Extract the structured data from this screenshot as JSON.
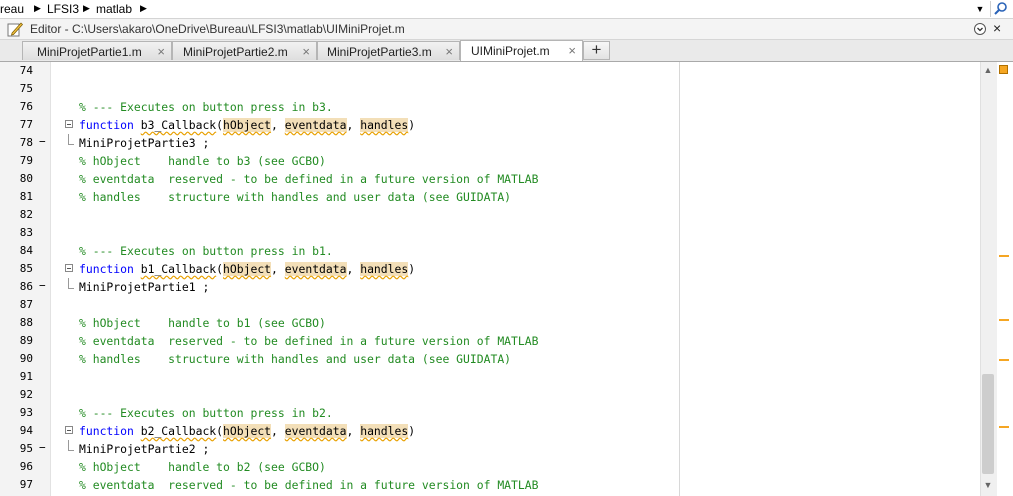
{
  "breadcrumb": {
    "items": [
      "reau",
      "LFSI3",
      "matlab"
    ]
  },
  "editor": {
    "title": "Editor - C:\\Users\\akaro\\OneDrive\\Bureau\\LFSI3\\matlab\\UIMiniProjet.m",
    "close_glyph": "×"
  },
  "tabs": [
    {
      "label": "MiniProjetPartie1.m",
      "active": false
    },
    {
      "label": "MiniProjetPartie2.m",
      "active": false
    },
    {
      "label": "MiniProjetPartie3.m",
      "active": false
    },
    {
      "label": "UIMiniProjet.m",
      "active": true
    }
  ],
  "tab_close_glyph": "×",
  "tab_add_glyph": "+",
  "colors": {
    "comment": "#228b22",
    "keyword": "#0000ff",
    "highlight": "#f3dfb8",
    "warning": "#f5a623"
  },
  "code_lines": [
    {
      "n": "74",
      "dash": "",
      "fold": "",
      "segments": []
    },
    {
      "n": "75",
      "dash": "",
      "fold": "",
      "segments": []
    },
    {
      "n": "76",
      "dash": "",
      "fold": "",
      "segments": [
        {
          "t": "% --- Executes on button press in b3.",
          "c": "cmt"
        }
      ]
    },
    {
      "n": "77",
      "dash": "",
      "fold": "start",
      "segments": [
        {
          "t": "function",
          "c": "kw"
        },
        {
          "t": " ",
          "c": ""
        },
        {
          "t": "b3_Callback",
          "c": "fn"
        },
        {
          "t": "(",
          "c": ""
        },
        {
          "t": "hObject",
          "c": "hl"
        },
        {
          "t": ", ",
          "c": ""
        },
        {
          "t": "eventdata",
          "c": "hl"
        },
        {
          "t": ", ",
          "c": ""
        },
        {
          "t": "handles",
          "c": "hl"
        },
        {
          "t": ")",
          "c": ""
        }
      ]
    },
    {
      "n": "78",
      "dash": "−",
      "fold": "end",
      "segments": [
        {
          "t": "MiniProjetPartie3 ;",
          "c": ""
        }
      ]
    },
    {
      "n": "79",
      "dash": "",
      "fold": "",
      "segments": [
        {
          "t": "% hObject    handle to b3 (see GCBO)",
          "c": "cmt"
        }
      ]
    },
    {
      "n": "80",
      "dash": "",
      "fold": "",
      "segments": [
        {
          "t": "% eventdata  reserved - to be defined in a future version of MATLAB",
          "c": "cmt"
        }
      ]
    },
    {
      "n": "81",
      "dash": "",
      "fold": "",
      "segments": [
        {
          "t": "% handles    structure with handles and user data (see GUIDATA)",
          "c": "cmt"
        }
      ]
    },
    {
      "n": "82",
      "dash": "",
      "fold": "",
      "segments": []
    },
    {
      "n": "83",
      "dash": "",
      "fold": "",
      "segments": []
    },
    {
      "n": "84",
      "dash": "",
      "fold": "",
      "segments": [
        {
          "t": "% --- Executes on button press in b1.",
          "c": "cmt"
        }
      ]
    },
    {
      "n": "85",
      "dash": "",
      "fold": "start",
      "segments": [
        {
          "t": "function",
          "c": "kw"
        },
        {
          "t": " ",
          "c": ""
        },
        {
          "t": "b1_Callback",
          "c": "fn"
        },
        {
          "t": "(",
          "c": ""
        },
        {
          "t": "hObject",
          "c": "hl"
        },
        {
          "t": ", ",
          "c": ""
        },
        {
          "t": "eventdata",
          "c": "hl"
        },
        {
          "t": ", ",
          "c": ""
        },
        {
          "t": "handles",
          "c": "hl"
        },
        {
          "t": ")",
          "c": ""
        }
      ]
    },
    {
      "n": "86",
      "dash": "−",
      "fold": "end",
      "segments": [
        {
          "t": "MiniProjetPartie1 ;",
          "c": ""
        }
      ]
    },
    {
      "n": "87",
      "dash": "",
      "fold": "",
      "segments": []
    },
    {
      "n": "88",
      "dash": "",
      "fold": "",
      "segments": [
        {
          "t": "% hObject    handle to b1 (see GCBO)",
          "c": "cmt"
        }
      ]
    },
    {
      "n": "89",
      "dash": "",
      "fold": "",
      "segments": [
        {
          "t": "% eventdata  reserved - to be defined in a future version of MATLAB",
          "c": "cmt"
        }
      ]
    },
    {
      "n": "90",
      "dash": "",
      "fold": "",
      "segments": [
        {
          "t": "% handles    structure with handles and user data (see GUIDATA)",
          "c": "cmt"
        }
      ]
    },
    {
      "n": "91",
      "dash": "",
      "fold": "",
      "segments": []
    },
    {
      "n": "92",
      "dash": "",
      "fold": "",
      "segments": []
    },
    {
      "n": "93",
      "dash": "",
      "fold": "",
      "segments": [
        {
          "t": "% --- Executes on button press in b2.",
          "c": "cmt"
        }
      ]
    },
    {
      "n": "94",
      "dash": "",
      "fold": "start",
      "segments": [
        {
          "t": "function",
          "c": "kw"
        },
        {
          "t": " ",
          "c": ""
        },
        {
          "t": "b2_Callback",
          "c": "fn"
        },
        {
          "t": "(",
          "c": ""
        },
        {
          "t": "hObject",
          "c": "hl"
        },
        {
          "t": ", ",
          "c": ""
        },
        {
          "t": "eventdata",
          "c": "hl"
        },
        {
          "t": ", ",
          "c": ""
        },
        {
          "t": "handles",
          "c": "hl"
        },
        {
          "t": ")",
          "c": ""
        }
      ]
    },
    {
      "n": "95",
      "dash": "−",
      "fold": "end",
      "segments": [
        {
          "t": "MiniProjetPartie2 ;",
          "c": ""
        }
      ]
    },
    {
      "n": "96",
      "dash": "",
      "fold": "",
      "segments": [
        {
          "t": "% hObject    handle to b2 (see GCBO)",
          "c": "cmt"
        }
      ]
    },
    {
      "n": "97",
      "dash": "",
      "fold": "",
      "segments": [
        {
          "t": "% eventdata  reserved - to be defined in a future version of MATLAB",
          "c": "cmt"
        }
      ]
    }
  ],
  "icons": {
    "crumb_separator": "caret-right-icon",
    "dropdown": "caret-down-icon",
    "search": "search-icon",
    "editor": "editor-pencil-icon",
    "menu": "options-menu-icon",
    "scroll_up": "scroll-up-icon",
    "scroll_down": "scroll-down-icon"
  },
  "glyphs": {
    "crumb_sep": "▶",
    "dropdown": "▼",
    "scroll_up": "▲",
    "scroll_down": "▼"
  }
}
